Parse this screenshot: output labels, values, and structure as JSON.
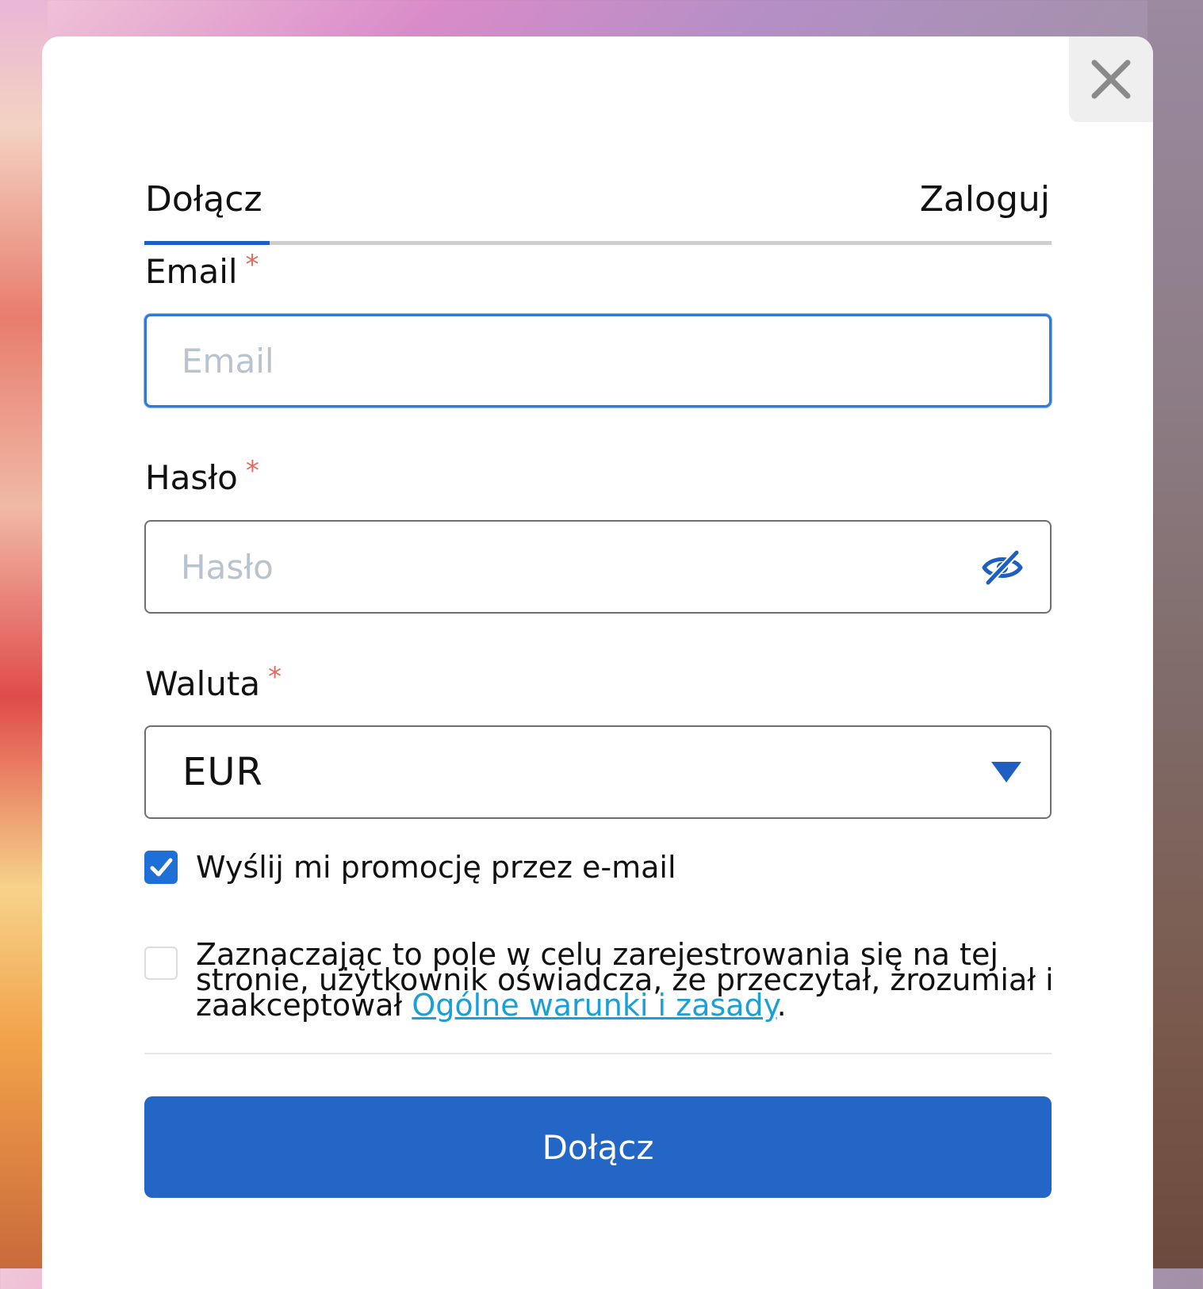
{
  "tabs": [
    {
      "label": "Dołącz",
      "active": true
    },
    {
      "label": "Zaloguj",
      "active": false
    }
  ],
  "email": {
    "label": "Email",
    "required_mark": "*",
    "placeholder": "Email",
    "value": ""
  },
  "password": {
    "label": "Hasło",
    "required_mark": "*",
    "placeholder": "Hasło",
    "value": "",
    "toggle_icon": "eye-slash-icon"
  },
  "currency": {
    "label": "Waluta",
    "required_mark": "*",
    "selected": "EUR",
    "arrow_icon": "chevron-down-icon"
  },
  "promo_checkbox": {
    "checked": true,
    "label": "Wyślij mi promocję przez e-mail"
  },
  "terms_checkbox": {
    "checked": false,
    "text_before": "Zaznaczając to pole w celu zarejestrowania się na tej stronie, użytkownik oświadcza, że przeczytał, zrozumiał i zaakceptował ",
    "link_text": "Ogólne warunki i zasady",
    "text_after": "."
  },
  "submit_label": "Dołącz",
  "close_icon": "close-icon",
  "colors": {
    "accent": "#1e5fc1",
    "button": "#2466c6",
    "required": "#e06b5a",
    "link": "#1a9fd6"
  }
}
